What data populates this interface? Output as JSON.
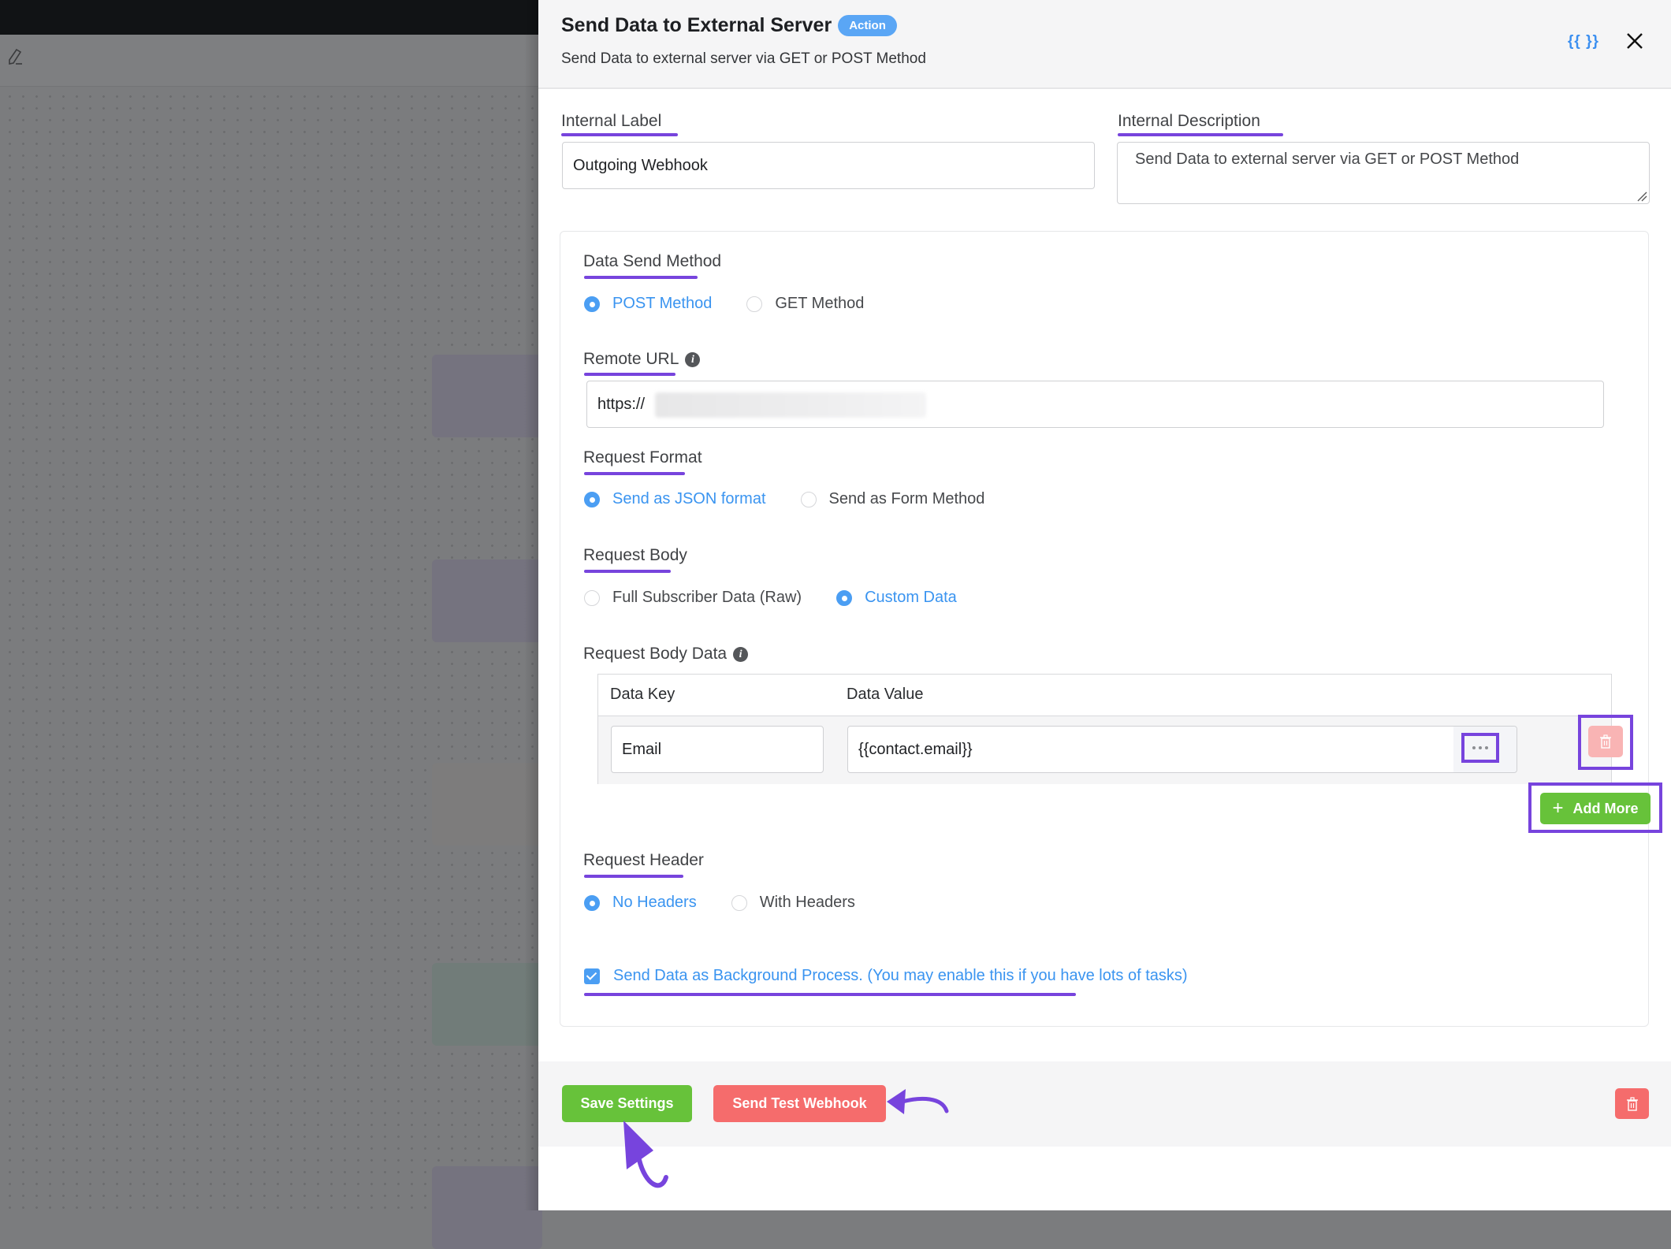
{
  "background": {
    "toolbar_icon": "pencil-icon"
  },
  "drawer": {
    "title": "Send Data to External Server",
    "badge": "Action",
    "subtitle": "Send Data to external server via GET or POST Method",
    "smartcodes_icon_label": "{{ }}",
    "close_icon": "close-icon"
  },
  "fields": {
    "internal_label": {
      "label": "Internal Label",
      "value": "Outgoing Webhook"
    },
    "internal_description": {
      "label": "Internal Description",
      "value": "Send Data to external server via GET or POST Method"
    }
  },
  "settings": {
    "data_send_method": {
      "label": "Data Send Method",
      "options": [
        {
          "label": "POST Method",
          "selected": true
        },
        {
          "label": "GET Method",
          "selected": false
        }
      ]
    },
    "remote_url": {
      "label": "Remote URL",
      "value": "https://",
      "value_note": "remainder blurred"
    },
    "request_format": {
      "label": "Request Format",
      "options": [
        {
          "label": "Send as JSON format",
          "selected": true
        },
        {
          "label": "Send as Form Method",
          "selected": false
        }
      ]
    },
    "request_body": {
      "label": "Request Body",
      "options": [
        {
          "label": "Full Subscriber Data (Raw)",
          "selected": false
        },
        {
          "label": "Custom Data",
          "selected": true
        }
      ]
    },
    "request_body_data": {
      "label": "Request Body Data",
      "columns": [
        "Data Key",
        "Data Value"
      ],
      "rows": [
        {
          "key": "Email",
          "value": "{{contact.email}}"
        }
      ],
      "add_more_label": "Add More"
    },
    "request_header": {
      "label": "Request Header",
      "options": [
        {
          "label": "No Headers",
          "selected": true
        },
        {
          "label": "With Headers",
          "selected": false
        }
      ]
    },
    "background_process": {
      "label": "Send Data as Background Process. (You may enable this if you have lots of tasks)",
      "checked": true
    }
  },
  "footer": {
    "save_label": "Save Settings",
    "test_label": "Send Test Webhook"
  },
  "colors": {
    "accent_blue": "#4b9ef3",
    "success_green": "#67c23a",
    "danger_red": "#f56c6c",
    "annotation_purple": "#7744dd"
  }
}
